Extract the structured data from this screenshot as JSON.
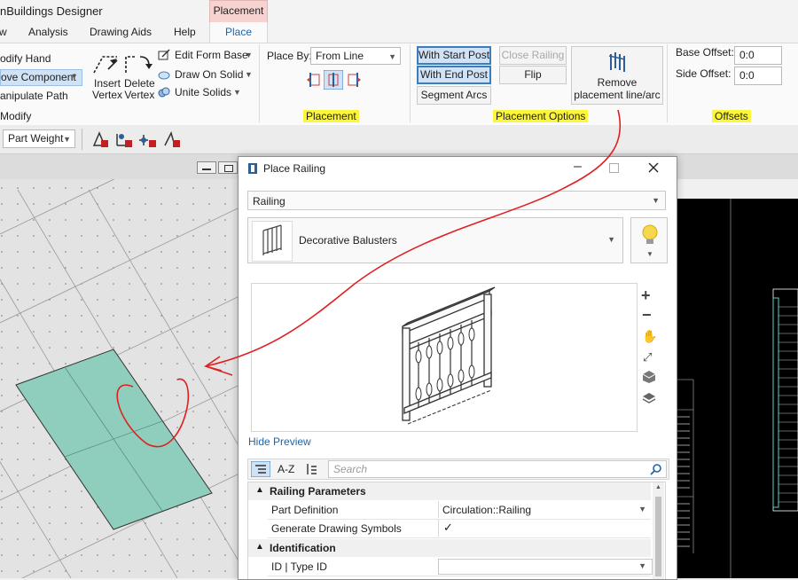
{
  "app": {
    "title": "nBuildings Designer"
  },
  "tabs": [
    {
      "label": "w"
    },
    {
      "label": "Analysis"
    },
    {
      "label": "Drawing Aids"
    },
    {
      "label": "Help"
    }
  ],
  "context_tab": {
    "header": "Placement",
    "active_tab": "Place"
  },
  "ribbon": {
    "modify": {
      "items": [
        "odify Hand",
        "ove Component",
        "anipulate Path"
      ],
      "insert_vertex": [
        "Insert",
        "Vertex"
      ],
      "delete_vertex": [
        "Delete",
        "Vertex"
      ],
      "edit_form_base": "Edit Form Base",
      "draw_on_solid": "Draw On Solid",
      "unite_solids": "Unite Solids",
      "group_label": "Modify"
    },
    "placement": {
      "place_by_label": "Place By:",
      "place_by_value": "From Line",
      "group_label": "Placement"
    },
    "placement_options": {
      "with_start_post": "With Start Post",
      "with_end_post": "With End Post",
      "segment_arcs": "Segment Arcs",
      "close_railing": "Close Railing",
      "flip": "Flip",
      "remove_label": [
        "Remove",
        "placement line/arc"
      ],
      "group_label": "Placement Options"
    },
    "offsets": {
      "base_offset_label": "Base Offset:",
      "base_offset_value": "0:0",
      "side_offset_label": "Side Offset:",
      "side_offset_value": "0:0",
      "group_label": "Offsets"
    }
  },
  "toolbar": {
    "part_weight": "Part Weight"
  },
  "dialog": {
    "title": "Place Railing",
    "type_select": "Railing",
    "style_name": "Decorative Balusters",
    "hide_preview": "Hide Preview",
    "search_placeholder": "Search",
    "sort_az": "A-Z",
    "categories": [
      {
        "name": "Railing Parameters",
        "rows": [
          {
            "name": "Part Definition",
            "value": "Circulation::Railing"
          },
          {
            "name": "Generate Drawing Symbols",
            "value": "✓"
          }
        ]
      },
      {
        "name": "Identification",
        "rows": [
          {
            "name": "ID | Type ID",
            "value": ""
          }
        ]
      }
    ]
  },
  "colors": {
    "accent": "#1f64a8",
    "highlight": "#fbf63a",
    "annotation": "#e02020",
    "slab": "#8fcdbd"
  }
}
